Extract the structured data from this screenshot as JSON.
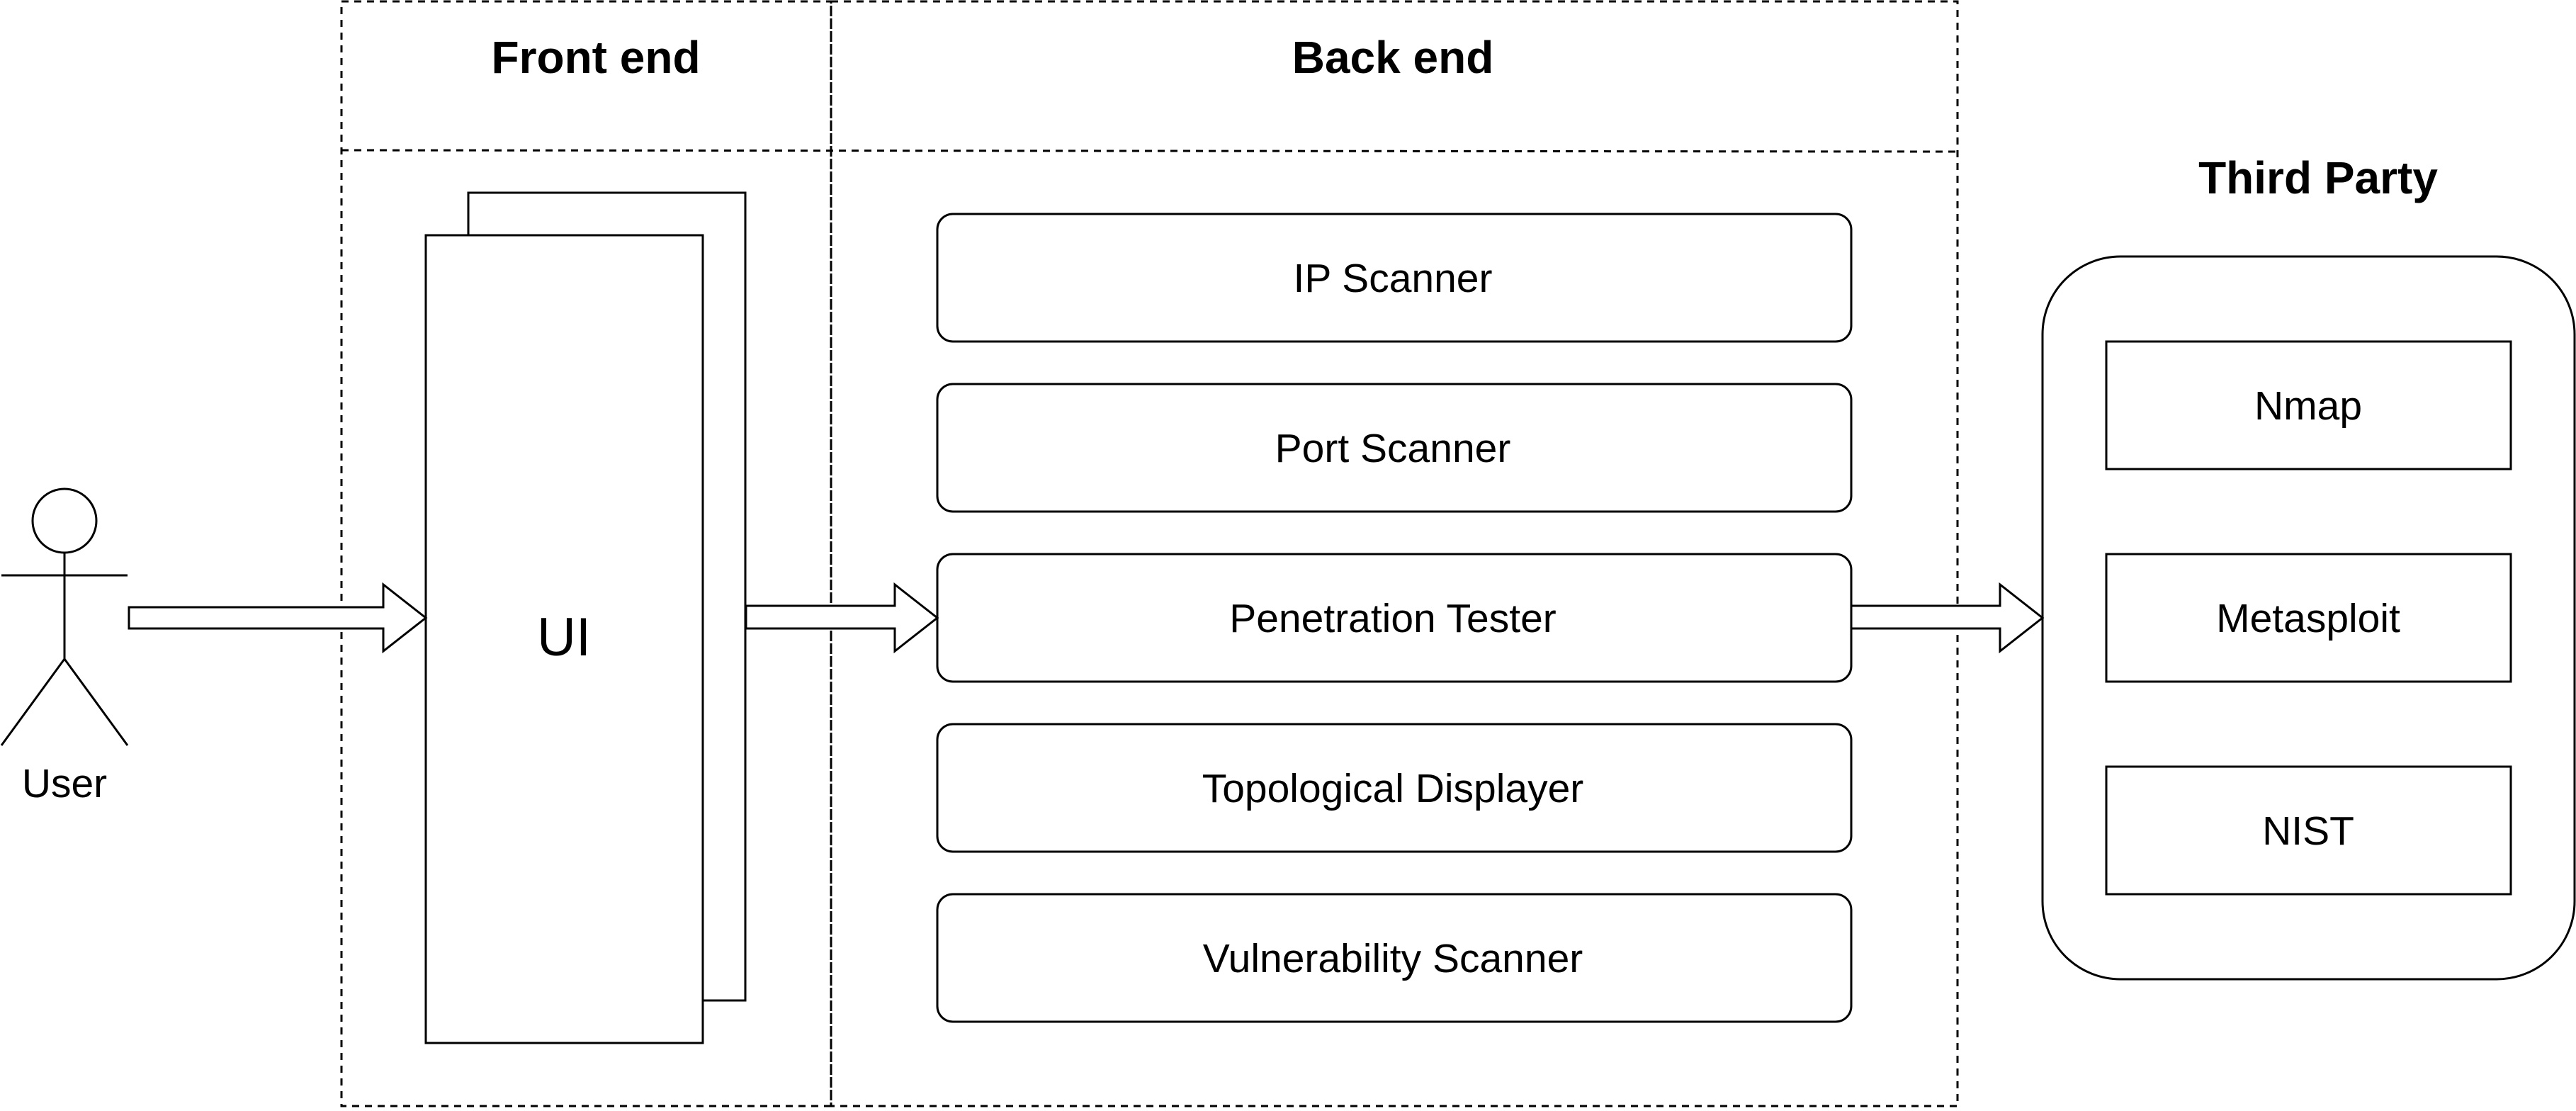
{
  "sections": {
    "front_end": "Front end",
    "back_end": "Back end",
    "third_party": "Third Party"
  },
  "actor": {
    "label": "User",
    "icon": "stick-figure-user-icon"
  },
  "front_end": {
    "ui_label": "UI"
  },
  "back_end": {
    "modules": [
      "IP Scanner",
      "Port Scanner",
      "Penetration Tester",
      "Topological Displayer",
      "Vulnerability Scanner"
    ]
  },
  "third_party": {
    "tools": [
      "Nmap",
      "Metasploit",
      "NIST"
    ]
  },
  "colors": {
    "stroke": "#000000",
    "fill": "#ffffff"
  }
}
